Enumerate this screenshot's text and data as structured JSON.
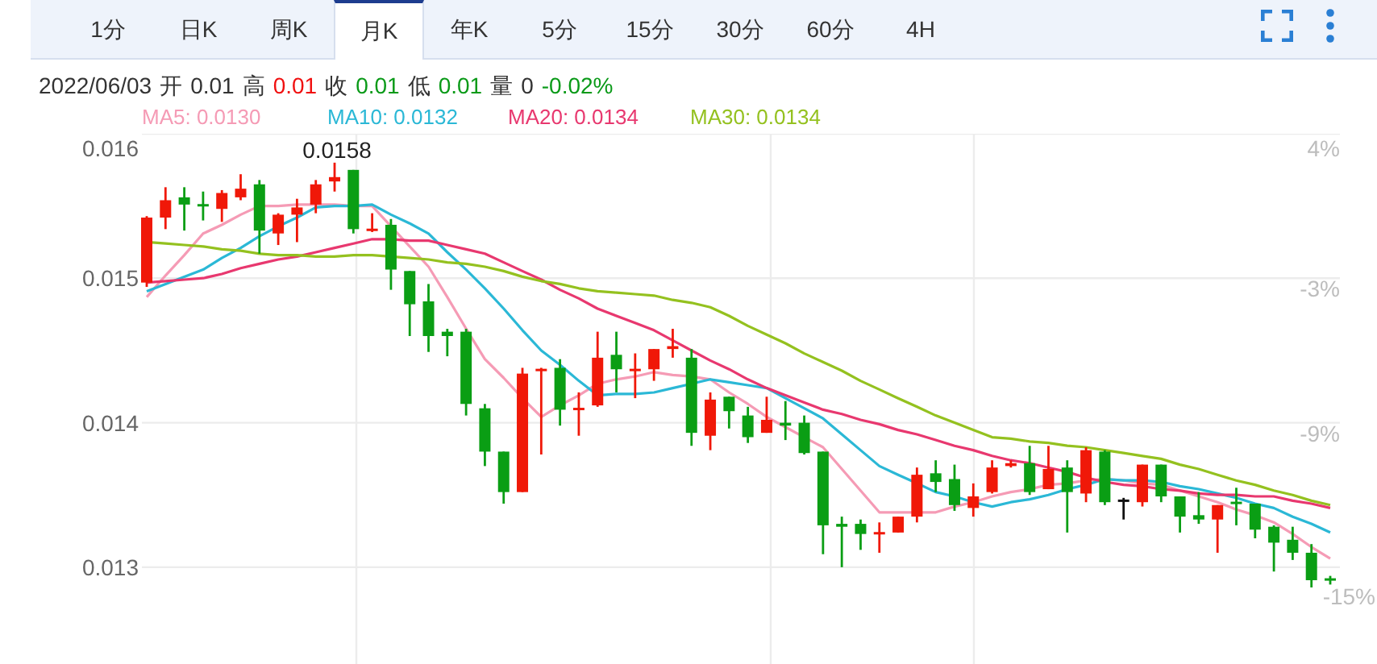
{
  "toolbar": {
    "tabs": [
      {
        "label": "1分",
        "selected": false
      },
      {
        "label": "日K",
        "selected": false
      },
      {
        "label": "周K",
        "selected": false
      },
      {
        "label": "月K",
        "selected": true
      },
      {
        "label": "年K",
        "selected": false
      },
      {
        "label": "5分",
        "selected": false
      },
      {
        "label": "15分",
        "selected": false
      },
      {
        "label": "30分",
        "selected": false
      },
      {
        "label": "60分",
        "selected": false
      },
      {
        "label": "4H",
        "selected": false
      }
    ]
  },
  "quote": {
    "date": "2022/06/03",
    "fields": [
      {
        "label": "开",
        "value": "0.01",
        "color": "#333333"
      },
      {
        "label": "高",
        "value": "0.01",
        "color": "#f01010"
      },
      {
        "label": "收",
        "value": "0.01",
        "color": "#0a9a18"
      },
      {
        "label": "低",
        "value": "0.01",
        "color": "#0a9a18"
      },
      {
        "label": "量",
        "value": "0",
        "color": "#333333"
      }
    ],
    "change": {
      "value": "-0.02%",
      "color": "#0a9a18"
    }
  },
  "chart": {
    "percent_axis": [
      "4%",
      "-3%",
      "-9%",
      "-15%"
    ],
    "peak_label": "0.0158",
    "chart_data": {
      "type": "candlestick",
      "grid": true,
      "ylim": [
        0.01233,
        0.016
      ],
      "yticks": [
        {
          "value": 0.016,
          "label": "0.016"
        },
        {
          "value": 0.015,
          "label": "0.015"
        },
        {
          "value": 0.014,
          "label": "0.014"
        },
        {
          "value": 0.013,
          "label": "0.013"
        }
      ],
      "ohlc": [
        [
          0.01497,
          0.01543,
          0.01494,
          0.01542
        ],
        [
          0.01542,
          0.01563,
          0.01534,
          0.01554
        ],
        [
          0.01556,
          0.01563,
          0.01533,
          0.01551
        ],
        [
          0.01551,
          0.0156,
          0.0154,
          0.0155
        ],
        [
          0.01548,
          0.01561,
          0.01539,
          0.01559
        ],
        [
          0.01556,
          0.01572,
          0.01554,
          0.01562
        ],
        [
          0.01565,
          0.01568,
          0.01517,
          0.01533
        ],
        [
          0.01531,
          0.01545,
          0.01523,
          0.01544
        ],
        [
          0.01544,
          0.01555,
          0.01525,
          0.01549
        ],
        [
          0.01551,
          0.01568,
          0.01545,
          0.01565
        ],
        [
          0.01567,
          0.0158,
          0.0156,
          0.0157
        ],
        [
          0.01575,
          0.01575,
          0.01531,
          0.01534
        ],
        [
          0.01533,
          0.01545,
          0.01532,
          0.01534
        ],
        [
          0.01537,
          0.01541,
          0.01492,
          0.01506
        ],
        [
          0.01505,
          0.01505,
          0.0146,
          0.01482
        ],
        [
          0.01484,
          0.01496,
          0.01449,
          0.0146
        ],
        [
          0.01463,
          0.01465,
          0.01446,
          0.0146
        ],
        [
          0.01463,
          0.01465,
          0.01405,
          0.01413
        ],
        [
          0.0141,
          0.01413,
          0.0137,
          0.0138
        ],
        [
          0.0138,
          0.0138,
          0.01344,
          0.01352
        ],
        [
          0.01352,
          0.01438,
          0.01352,
          0.01434
        ],
        [
          0.01436,
          0.01438,
          0.01378,
          0.01437
        ],
        [
          0.01438,
          0.01444,
          0.01398,
          0.01409
        ],
        [
          0.01409,
          0.01421,
          0.01391,
          0.0141
        ],
        [
          0.01412,
          0.01463,
          0.01411,
          0.01445
        ],
        [
          0.01447,
          0.01463,
          0.01421,
          0.01437
        ],
        [
          0.01436,
          0.01448,
          0.01417,
          0.01437
        ],
        [
          0.01437,
          0.01451,
          0.01429,
          0.01451
        ],
        [
          0.01451,
          0.01465,
          0.01445,
          0.01453
        ],
        [
          0.01445,
          0.01451,
          0.01384,
          0.01393
        ],
        [
          0.01391,
          0.01421,
          0.01381,
          0.01416
        ],
        [
          0.01418,
          0.01418,
          0.01396,
          0.01408
        ],
        [
          0.01405,
          0.01411,
          0.01386,
          0.0139
        ],
        [
          0.01393,
          0.01418,
          0.01393,
          0.01402
        ],
        [
          0.014,
          0.01415,
          0.01388,
          0.01398
        ],
        [
          0.014,
          0.01405,
          0.01378,
          0.01379
        ],
        [
          0.0138,
          0.0138,
          0.01309,
          0.01329
        ],
        [
          0.0133,
          0.01335,
          0.013,
          0.01328
        ],
        [
          0.0133,
          0.01333,
          0.01312,
          0.01323
        ],
        [
          0.01323,
          0.01331,
          0.0131,
          0.01324
        ],
        [
          0.01324,
          0.01335,
          0.01324,
          0.01335
        ],
        [
          0.01335,
          0.01369,
          0.01331,
          0.01364
        ],
        [
          0.01365,
          0.01374,
          0.01352,
          0.01359
        ],
        [
          0.01361,
          0.01371,
          0.01339,
          0.01343
        ],
        [
          0.01341,
          0.01358,
          0.01335,
          0.01349
        ],
        [
          0.01352,
          0.01374,
          0.01351,
          0.01369
        ],
        [
          0.0137,
          0.01374,
          0.01369,
          0.01372
        ],
        [
          0.01372,
          0.01384,
          0.0135,
          0.01352
        ],
        [
          0.01354,
          0.01384,
          0.01354,
          0.01368
        ],
        [
          0.01369,
          0.01374,
          0.01324,
          0.01352
        ],
        [
          0.01351,
          0.01383,
          0.01345,
          0.01381
        ],
        [
          0.0138,
          0.01381,
          0.01343,
          0.01345
        ],
        [
          0.01346,
          0.01348,
          0.01333,
          0.01346
        ],
        [
          0.01345,
          0.01371,
          0.01342,
          0.01371
        ],
        [
          0.01371,
          0.01371,
          0.01345,
          0.01349
        ],
        [
          0.01349,
          0.01349,
          0.01324,
          0.01335
        ],
        [
          0.01336,
          0.01352,
          0.0133,
          0.01333
        ],
        [
          0.01333,
          0.01343,
          0.0131,
          0.01343
        ],
        [
          0.01345,
          0.01355,
          0.01329,
          0.01344
        ],
        [
          0.01344,
          0.01344,
          0.0132,
          0.01326
        ],
        [
          0.01328,
          0.01329,
          0.01297,
          0.01317
        ],
        [
          0.01319,
          0.01328,
          0.01305,
          0.0131
        ],
        [
          0.0131,
          0.01316,
          0.01286,
          0.01291
        ],
        [
          0.01292,
          0.01294,
          0.01288,
          0.01291
        ]
      ],
      "series": [
        {
          "name": "MA5: 0.0130",
          "type": "line",
          "color": "#f59bb5",
          "values": [
            0.01487,
            0.01502,
            0.01516,
            0.01531,
            0.01537,
            0.01544,
            0.0155,
            0.0155,
            0.01551,
            0.01551,
            0.01551,
            0.0155,
            0.0155,
            0.01536,
            0.01522,
            0.01508,
            0.01487,
            0.01465,
            0.01444,
            0.01431,
            0.01417,
            0.01404,
            0.01412,
            0.01419,
            0.01427,
            0.0143,
            0.01432,
            0.01435,
            0.01433,
            0.01432,
            0.0143,
            0.01421,
            0.01413,
            0.01404,
            0.01397,
            0.0139,
            0.01383,
            0.01368,
            0.01353,
            0.01338,
            0.01338,
            0.01338,
            0.01338,
            0.01342,
            0.01345,
            0.01349,
            0.01352,
            0.01354,
            0.01357,
            0.01358,
            0.0136,
            0.01361,
            0.0136,
            0.01358,
            0.01357,
            0.01353,
            0.01349,
            0.01345,
            0.0134,
            0.01336,
            0.01331,
            0.01323,
            0.01314,
            0.01306
          ]
        },
        {
          "name": "MA10: 0.0132",
          "type": "line",
          "color": "#2bb8d6",
          "values": [
            0.01491,
            0.01496,
            0.01501,
            0.01506,
            0.01514,
            0.01521,
            0.01529,
            0.01536,
            0.01542,
            0.01549,
            0.0155,
            0.0155,
            0.01551,
            0.01544,
            0.01538,
            0.01531,
            0.01518,
            0.01506,
            0.01493,
            0.01479,
            0.01464,
            0.0145,
            0.0144,
            0.01429,
            0.01419,
            0.0142,
            0.0142,
            0.01421,
            0.01424,
            0.01427,
            0.0143,
            0.01428,
            0.01426,
            0.01424,
            0.01417,
            0.0141,
            0.01403,
            0.01392,
            0.01381,
            0.0137,
            0.01364,
            0.01358,
            0.01352,
            0.01349,
            0.01345,
            0.01342,
            0.01345,
            0.01347,
            0.0135,
            0.01354,
            0.01357,
            0.01361,
            0.0136,
            0.0136,
            0.01359,
            0.01356,
            0.01354,
            0.01351,
            0.01348,
            0.01344,
            0.01341,
            0.01335,
            0.0133,
            0.01324
          ]
        },
        {
          "name": "MA20: 0.0134",
          "type": "line",
          "color": "#e8386f",
          "values": [
            0.01497,
            0.01498,
            0.01499,
            0.015,
            0.01503,
            0.01507,
            0.0151,
            0.01513,
            0.01515,
            0.01518,
            0.01521,
            0.01524,
            0.01527,
            0.01527,
            0.01526,
            0.01526,
            0.01523,
            0.0152,
            0.01517,
            0.01511,
            0.01505,
            0.01499,
            0.01492,
            0.01486,
            0.01479,
            0.01474,
            0.01469,
            0.01464,
            0.01457,
            0.0145,
            0.01443,
            0.01437,
            0.0143,
            0.01424,
            0.01419,
            0.01414,
            0.01409,
            0.01406,
            0.01402,
            0.01399,
            0.01395,
            0.01392,
            0.01388,
            0.01384,
            0.01381,
            0.01377,
            0.01374,
            0.01372,
            0.01369,
            0.01366,
            0.01362,
            0.01359,
            0.01357,
            0.01356,
            0.01354,
            0.01353,
            0.01351,
            0.0135,
            0.0135,
            0.01349,
            0.01349,
            0.01346,
            0.01344,
            0.01341
          ]
        },
        {
          "name": "MA30: 0.0134",
          "type": "line",
          "color": "#94c11f",
          "values": [
            0.01525,
            0.01524,
            0.01523,
            0.01522,
            0.0152,
            0.01519,
            0.01517,
            0.01516,
            0.01516,
            0.01515,
            0.01515,
            0.01516,
            0.01516,
            0.01515,
            0.01514,
            0.01513,
            0.01511,
            0.0151,
            0.01508,
            0.01505,
            0.01501,
            0.01498,
            0.01496,
            0.01493,
            0.01491,
            0.0149,
            0.01489,
            0.01488,
            0.01485,
            0.01483,
            0.0148,
            0.01474,
            0.01467,
            0.01461,
            0.01455,
            0.01448,
            0.01442,
            0.01436,
            0.01429,
            0.01423,
            0.01417,
            0.01411,
            0.01405,
            0.014,
            0.01395,
            0.0139,
            0.01389,
            0.01387,
            0.01386,
            0.01384,
            0.01383,
            0.01381,
            0.01379,
            0.01377,
            0.01375,
            0.01371,
            0.01368,
            0.01364,
            0.0136,
            0.01357,
            0.01353,
            0.0135,
            0.01346,
            0.01343
          ]
        }
      ]
    }
  }
}
